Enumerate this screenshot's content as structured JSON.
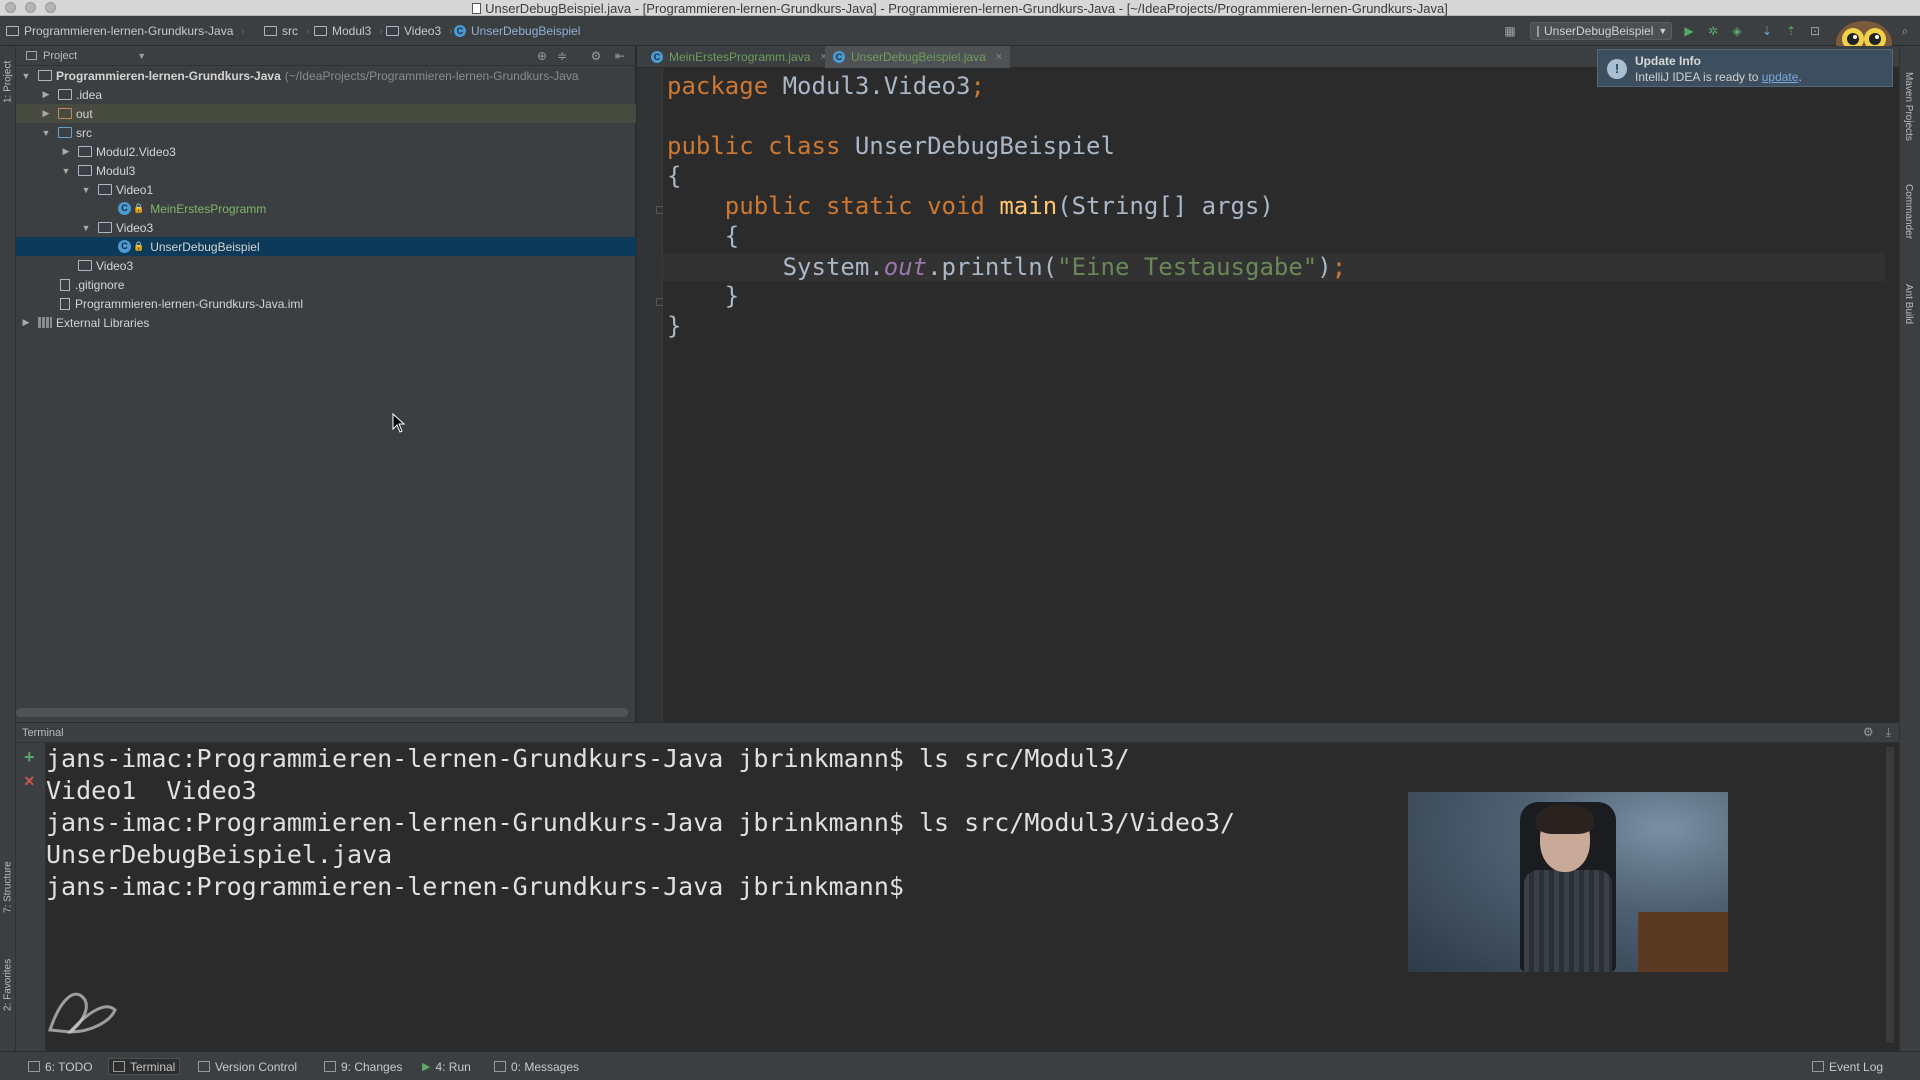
{
  "window": {
    "title": "UnserDebugBeispiel.java - [Programmieren-lernen-Grundkurs-Java] - Programmieren-lernen-Grundkurs-Java - [~/IdeaProjects/Programmieren-lernen-Grundkurs-Java]"
  },
  "breadcrumb": [
    {
      "label": "Programmieren-lernen-Grundkurs-Java",
      "icon": "project-folder-icon"
    },
    {
      "label": "src",
      "icon": "folder-icon"
    },
    {
      "label": "Modul3",
      "icon": "folder-icon"
    },
    {
      "label": "Video3",
      "icon": "folder-icon"
    },
    {
      "label": "UnserDebugBeispiel",
      "icon": "class-icon"
    }
  ],
  "toolbar": {
    "run_config": "UnserDebugBeispiel"
  },
  "left_tabs": {
    "project": "1: Project",
    "structure": "7: Structure",
    "favorites": "2: Favorites"
  },
  "right_tabs": {
    "maven": "Maven Projects",
    "commander": "Commander",
    "ant": "Ant Build"
  },
  "project_panel": {
    "header": "Project",
    "tree": [
      {
        "label": "Programmieren-lernen-Grundkurs-Java",
        "hint": "(~/IdeaProjects/Programmieren-lernen-Grundkurs-Java",
        "bold": true
      },
      {
        "label": ".idea"
      },
      {
        "label": "out"
      },
      {
        "label": "src"
      },
      {
        "label": "Modul2.Video3"
      },
      {
        "label": "Modul3"
      },
      {
        "label": "Video1"
      },
      {
        "label": "MeinErstesProgramm"
      },
      {
        "label": "Video3"
      },
      {
        "label": "UnserDebugBeispiel"
      },
      {
        "label": "Video3"
      },
      {
        "label": ".gitignore"
      },
      {
        "label": "Programmieren-lernen-Grundkurs-Java.iml"
      },
      {
        "label": "External Libraries"
      }
    ]
  },
  "editor": {
    "tabs": [
      {
        "label": "MeinErstesProgramm.java",
        "active": false
      },
      {
        "label": "UnserDebugBeispiel.java",
        "active": true
      }
    ],
    "code": {
      "l1_kw": "package",
      "l1_rest": " Modul3.Video3",
      "l1_semi": ";",
      "l2_kw": "public class",
      "l2_cls": " UnserDebugBeispiel",
      "l3": "{",
      "l4_kw": "    public static void",
      "l4_fn": " main",
      "l4_rest": "(String[] args)",
      "l5": "    {",
      "l6_a": "        System.",
      "l6_fld": "out",
      "l6_b": ".println(",
      "l6_str": "\"Eine Testausgabe\"",
      "l6_c": ")",
      "l6_semi": ";",
      "l7": "    }",
      "l8": "}"
    }
  },
  "notification": {
    "title": "Update Info",
    "body": "IntelliJ IDEA is ready to ",
    "link": "update",
    "tail": "."
  },
  "terminal": {
    "header": "Terminal",
    "lines": [
      "jans-imac:Programmieren-lernen-Grundkurs-Java jbrinkmann$ ls src/Modul3/",
      "Video1  Video3",
      "jans-imac:Programmieren-lernen-Grundkurs-Java jbrinkmann$ ls src/Modul3/Video3/",
      "UnserDebugBeispiel.java",
      "jans-imac:Programmieren-lernen-Grundkurs-Java jbrinkmann$"
    ]
  },
  "statusbar": {
    "items": [
      {
        "label": "6: TODO"
      },
      {
        "label": "Terminal"
      },
      {
        "label": "Version Control"
      },
      {
        "label": "9: Changes"
      },
      {
        "label": "4: Run"
      },
      {
        "label": "0: Messages"
      }
    ],
    "event_log": "Event Log"
  }
}
